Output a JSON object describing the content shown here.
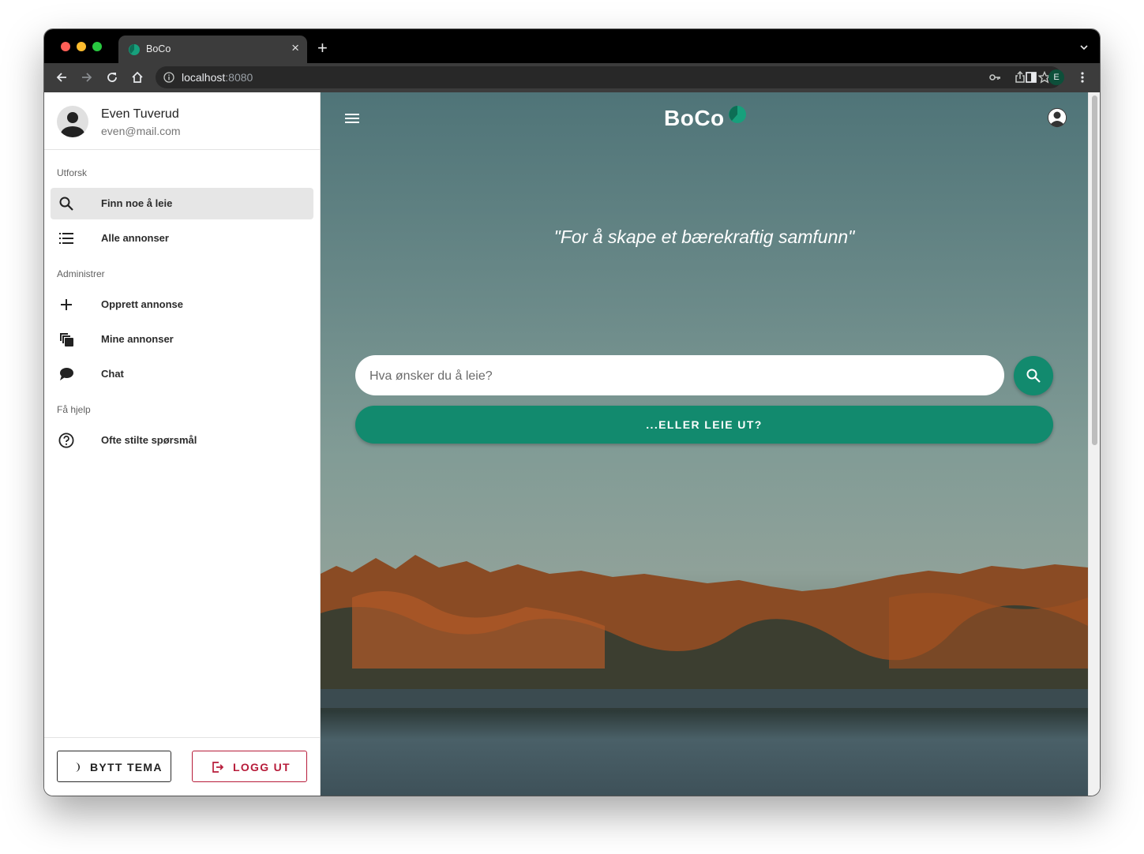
{
  "browser": {
    "tab_title": "BoCo",
    "tab_close": "×",
    "new_tab": "+",
    "url_host": "localhost",
    "url_port": ":8080",
    "profile_initial": "E"
  },
  "colors": {
    "accent": "#128a6e",
    "logout": "#b71c3a"
  },
  "sidebar": {
    "user_name": "Even Tuverud",
    "user_email": "even@mail.com",
    "sections": {
      "explore": "Utforsk",
      "manage": "Administrer",
      "help": "Få hjelp"
    },
    "items": [
      {
        "label": "Finn noe å leie",
        "icon": "search-icon",
        "active": true
      },
      {
        "label": "Alle annonser",
        "icon": "list-icon"
      },
      {
        "label": "Opprett annonse",
        "icon": "plus-icon"
      },
      {
        "label": "Mine annonser",
        "icon": "copy-icon"
      },
      {
        "label": "Chat",
        "icon": "chat-icon"
      },
      {
        "label": "Ofte stilte spørsmål",
        "icon": "help-icon"
      }
    ],
    "theme_button": "BYTT TEMA",
    "logout_button": "LOGG UT"
  },
  "main": {
    "logo": "BoCo",
    "tagline": "\"For å skape et bærekraftig samfunn\"",
    "search_placeholder": "Hva ønsker du å leie?",
    "rent_out_button": "...ELLER LEIE UT?"
  }
}
